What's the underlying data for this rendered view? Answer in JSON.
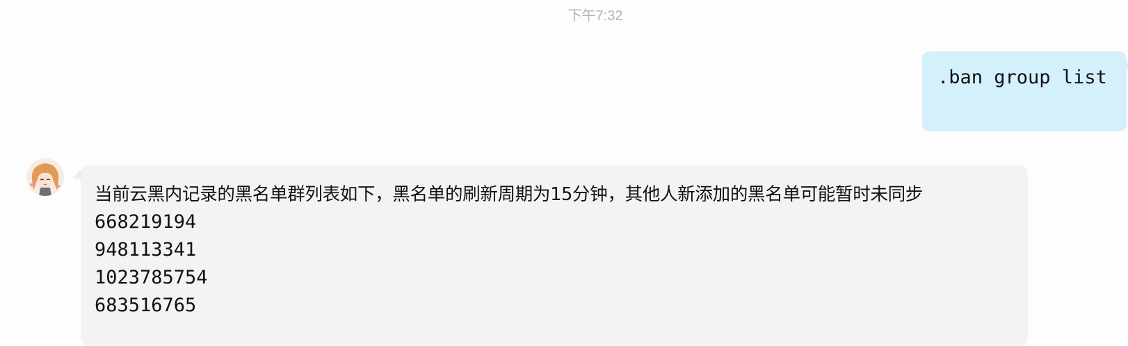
{
  "chat": {
    "timestamp": "下午7:32",
    "outgoing_message": ".ban group list",
    "incoming_message": {
      "header": "当前云黑内记录的黑名单群列表如下，黑名单的刷新周期为15分钟，其他人新添加的黑名单可能暂时未同步",
      "groups": [
        "668219194",
        "948113341",
        "1023785754",
        "683516765"
      ]
    }
  },
  "colors": {
    "outgoing_bubble": "#d4f1fb",
    "incoming_bubble": "#f3f3f3",
    "timestamp_text": "#b4b4b4"
  },
  "icons": {
    "avatar": "anime-girl-avatar"
  }
}
